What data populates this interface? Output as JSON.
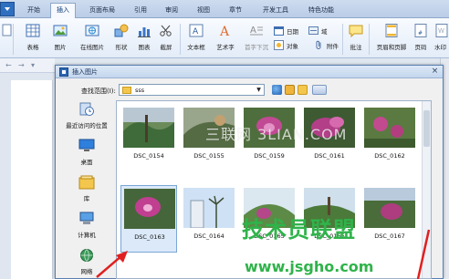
{
  "tabs": [
    "开始",
    "插入",
    "页面布局",
    "引用",
    "审阅",
    "视图",
    "章节",
    "开发工具",
    "特色功能"
  ],
  "active_tab": "插入",
  "ribbon": {
    "table": "表格",
    "picture": "图片",
    "online_picture": "在线图片",
    "shape": "形状",
    "chart": "图表",
    "screenshot": "截屏",
    "text_box": "文本框",
    "art_text": "艺术字",
    "vertical_text": "首字下沉",
    "date": "日期",
    "field": "域",
    "object": "对象",
    "attachment": "附件",
    "comment": "批注",
    "header_footer": "页眉和页脚",
    "page_number": "页码",
    "watermark": "水印"
  },
  "dialog": {
    "title": "插入图片",
    "look_in_label": "查找范围(I):",
    "look_in_value": "sss",
    "close": "×",
    "places": [
      "最近访问的位置",
      "桌面",
      "库",
      "计算机",
      "网络"
    ],
    "files": [
      "DSC_0154",
      "DSC_0155",
      "DSC_0159",
      "DSC_0161",
      "DSC_0162",
      "DSC_0163",
      "DSC_0164",
      "DSC_0165",
      "DSC_0166",
      "DSC_0167"
    ],
    "selected_file": "DSC_0163"
  },
  "watermarks": {
    "top": "三联网 3LIAN.COM",
    "cn": "技术员联盟",
    "url": "www.jsgho.com"
  },
  "colors": {
    "ribbon_bg": "#e3ecf8",
    "dialog_bg": "#f0f0f0",
    "selection": "#dbe9f8",
    "watermark_green": "#2fb34a",
    "arrow_red": "#e02020"
  }
}
